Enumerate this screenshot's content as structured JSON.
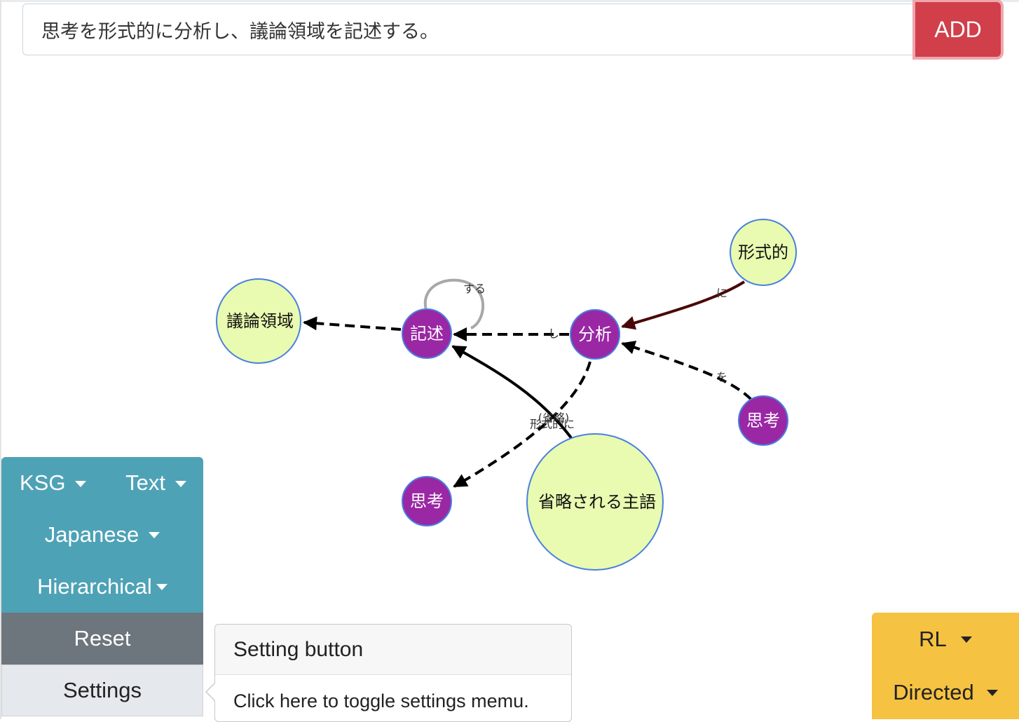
{
  "input": {
    "value": "思考を形式的に分析し、議論領域を記述する。"
  },
  "add_button": {
    "label": "ADD"
  },
  "graph": {
    "nodes": [
      {
        "id": "giron",
        "label": "議論領域",
        "kind": "entity"
      },
      {
        "id": "kijutsu",
        "label": "記述",
        "kind": "action"
      },
      {
        "id": "bunseki",
        "label": "分析",
        "kind": "action"
      },
      {
        "id": "keishiki",
        "label": "形式的",
        "kind": "entity"
      },
      {
        "id": "shikou1",
        "label": "思考",
        "kind": "action"
      },
      {
        "id": "shikou2",
        "label": "思考",
        "kind": "action"
      },
      {
        "id": "shuryaku",
        "label": "省略される主語",
        "kind": "entity"
      }
    ],
    "edges": [
      {
        "from": "kijutsu",
        "to": "giron",
        "label": "",
        "style": "dashed"
      },
      {
        "from": "kijutsu",
        "to": "kijutsu",
        "label": "する",
        "style": "loop"
      },
      {
        "from": "bunseki",
        "to": "kijutsu",
        "label": "し",
        "style": "dashed"
      },
      {
        "from": "keishiki",
        "to": "bunseki",
        "label": "に",
        "style": "solid-dark"
      },
      {
        "from": "shikou1",
        "to": "bunseki",
        "label": "を",
        "style": "dashed"
      },
      {
        "from": "bunseki",
        "to": "shikou2",
        "label": "形式的に",
        "style": "dashed"
      },
      {
        "from": "shuryaku",
        "to": "kijutsu",
        "label": "(省略)",
        "style": "solid"
      }
    ],
    "colors": {
      "entity_fill": "#e8fbb0",
      "action_fill": "#9a27a4",
      "node_border": "#4a7fe0",
      "edge": "#000000",
      "edge_dark": "#4a0808",
      "loop": "#a8a8a8"
    }
  },
  "left_panel": {
    "ksg": "KSG",
    "text": "Text",
    "language": "Japanese",
    "layout": "Hierarchical",
    "reset": "Reset",
    "settings": "Settings"
  },
  "popover": {
    "title": "Setting button",
    "body": "Click here to toggle settings memu."
  },
  "right_panel": {
    "direction": "RL",
    "mode": "Directed"
  }
}
